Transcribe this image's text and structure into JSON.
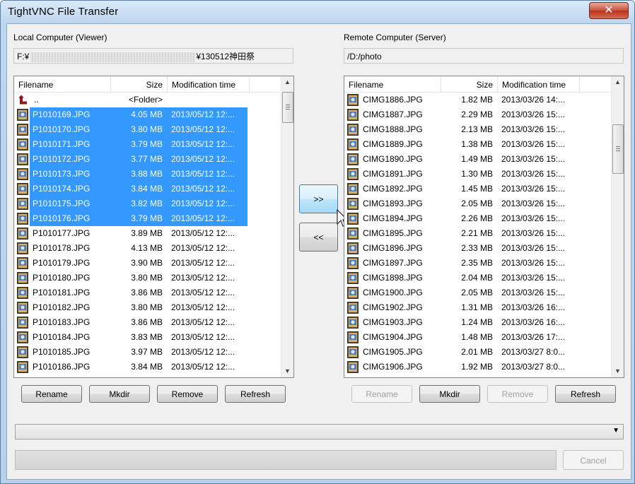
{
  "window": {
    "title": "TightVNC File Transfer",
    "close_glyph": "✕"
  },
  "local": {
    "label": "Local Computer (Viewer)",
    "path_prefix": "F:¥",
    "path_suffix": "¥130512神田祭",
    "columns": [
      "Filename",
      "Size",
      "Modification time"
    ],
    "parent_name": "..",
    "parent_size": "<Folder>",
    "files": [
      {
        "name": "P1010169.JPG",
        "size": "4.05 MB",
        "time": "2013/05/12 12:...",
        "selected": true
      },
      {
        "name": "P1010170.JPG",
        "size": "3.80 MB",
        "time": "2013/05/12 12:...",
        "selected": true
      },
      {
        "name": "P1010171.JPG",
        "size": "3.79 MB",
        "time": "2013/05/12 12:...",
        "selected": true
      },
      {
        "name": "P1010172.JPG",
        "size": "3.77 MB",
        "time": "2013/05/12 12:...",
        "selected": true
      },
      {
        "name": "P1010173.JPG",
        "size": "3.88 MB",
        "time": "2013/05/12 12:...",
        "selected": true
      },
      {
        "name": "P1010174.JPG",
        "size": "3.84 MB",
        "time": "2013/05/12 12:...",
        "selected": true
      },
      {
        "name": "P1010175.JPG",
        "size": "3.82 MB",
        "time": "2013/05/12 12:...",
        "selected": true
      },
      {
        "name": "P1010176.JPG",
        "size": "3.79 MB",
        "time": "2013/05/12 12:...",
        "selected": true
      },
      {
        "name": "P1010177.JPG",
        "size": "3.89 MB",
        "time": "2013/05/12 12:...",
        "selected": false
      },
      {
        "name": "P1010178.JPG",
        "size": "4.13 MB",
        "time": "2013/05/12 12:...",
        "selected": false
      },
      {
        "name": "P1010179.JPG",
        "size": "3.90 MB",
        "time": "2013/05/12 12:...",
        "selected": false
      },
      {
        "name": "P1010180.JPG",
        "size": "3.80 MB",
        "time": "2013/05/12 12:...",
        "selected": false
      },
      {
        "name": "P1010181.JPG",
        "size": "3.86 MB",
        "time": "2013/05/12 12:...",
        "selected": false
      },
      {
        "name": "P1010182.JPG",
        "size": "3.80 MB",
        "time": "2013/05/12 12:...",
        "selected": false
      },
      {
        "name": "P1010183.JPG",
        "size": "3.86 MB",
        "time": "2013/05/12 12:...",
        "selected": false
      },
      {
        "name": "P1010184.JPG",
        "size": "3.83 MB",
        "time": "2013/05/12 12:...",
        "selected": false
      },
      {
        "name": "P1010185.JPG",
        "size": "3.97 MB",
        "time": "2013/05/12 12:...",
        "selected": false
      },
      {
        "name": "P1010186.JPG",
        "size": "3.84 MB",
        "time": "2013/05/12 12:...",
        "selected": false
      }
    ],
    "buttons": {
      "rename": "Rename",
      "mkdir": "Mkdir",
      "remove": "Remove",
      "refresh": "Refresh"
    }
  },
  "remote": {
    "label": "Remote Computer (Server)",
    "path": "/D:/photo",
    "columns": [
      "Filename",
      "Size",
      "Modification time"
    ],
    "files": [
      {
        "name": "CIMG1886.JPG",
        "size": "1.82 MB",
        "time": "2013/03/26 14:..."
      },
      {
        "name": "CIMG1887.JPG",
        "size": "2.29 MB",
        "time": "2013/03/26 15:..."
      },
      {
        "name": "CIMG1888.JPG",
        "size": "2.13 MB",
        "time": "2013/03/26 15:..."
      },
      {
        "name": "CIMG1889.JPG",
        "size": "1.38 MB",
        "time": "2013/03/26 15:..."
      },
      {
        "name": "CIMG1890.JPG",
        "size": "1.49 MB",
        "time": "2013/03/26 15:..."
      },
      {
        "name": "CIMG1891.JPG",
        "size": "1.30 MB",
        "time": "2013/03/26 15:..."
      },
      {
        "name": "CIMG1892.JPG",
        "size": "1.45 MB",
        "time": "2013/03/26 15:..."
      },
      {
        "name": "CIMG1893.JPG",
        "size": "2.05 MB",
        "time": "2013/03/26 15:..."
      },
      {
        "name": "CIMG1894.JPG",
        "size": "2.26 MB",
        "time": "2013/03/26 15:..."
      },
      {
        "name": "CIMG1895.JPG",
        "size": "2.21 MB",
        "time": "2013/03/26 15:..."
      },
      {
        "name": "CIMG1896.JPG",
        "size": "2.33 MB",
        "time": "2013/03/26 15:..."
      },
      {
        "name": "CIMG1897.JPG",
        "size": "2.35 MB",
        "time": "2013/03/26 15:..."
      },
      {
        "name": "CIMG1898.JPG",
        "size": "2.04 MB",
        "time": "2013/03/26 15:..."
      },
      {
        "name": "CIMG1900.JPG",
        "size": "2.05 MB",
        "time": "2013/03/26 15:..."
      },
      {
        "name": "CIMG1902.JPG",
        "size": "1.31 MB",
        "time": "2013/03/26 16:..."
      },
      {
        "name": "CIMG1903.JPG",
        "size": "1.24 MB",
        "time": "2013/03/26 16:..."
      },
      {
        "name": "CIMG1904.JPG",
        "size": "1.48 MB",
        "time": "2013/03/26 17:..."
      },
      {
        "name": "CIMG1905.JPG",
        "size": "2.01 MB",
        "time": "2013/03/27 8:0..."
      },
      {
        "name": "CIMG1906.JPG",
        "size": "1.92 MB",
        "time": "2013/03/27 8:0..."
      }
    ],
    "buttons": {
      "rename": "Rename",
      "mkdir": "Mkdir",
      "remove": "Remove",
      "refresh": "Refresh"
    }
  },
  "transfer": {
    "upload": ">>",
    "download": "<<"
  },
  "cancel": "Cancel",
  "icons": {
    "file": "jpg-file-icon",
    "parent": "up-folder-icon",
    "scroll_up": "▲",
    "scroll_down": "▼",
    "combo": "▼"
  }
}
